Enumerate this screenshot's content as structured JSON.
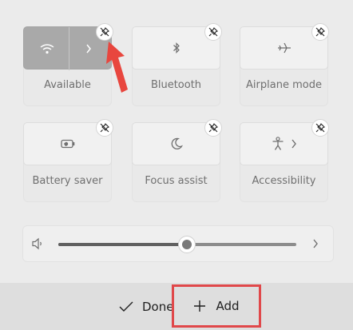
{
  "tiles": [
    {
      "label": "Available",
      "icon": "wifi-icon",
      "active": true,
      "has_chevron": true
    },
    {
      "label": "Bluetooth",
      "icon": "bluetooth-icon",
      "active": false,
      "has_chevron": false
    },
    {
      "label": "Airplane mode",
      "icon": "airplane-icon",
      "active": false,
      "has_chevron": false
    },
    {
      "label": "Battery saver",
      "icon": "battery-saver-icon",
      "active": false,
      "has_chevron": false
    },
    {
      "label": "Focus assist",
      "icon": "moon-icon",
      "active": false,
      "has_chevron": false
    },
    {
      "label": "Accessibility",
      "icon": "accessibility-icon",
      "active": false,
      "has_chevron": true
    }
  ],
  "volume": {
    "level_fraction": 0.54
  },
  "footer": {
    "done_label": "Done",
    "add_label": "Add"
  },
  "colors": {
    "highlight": "#e0484a",
    "annotation_arrow": "#e8463e"
  }
}
